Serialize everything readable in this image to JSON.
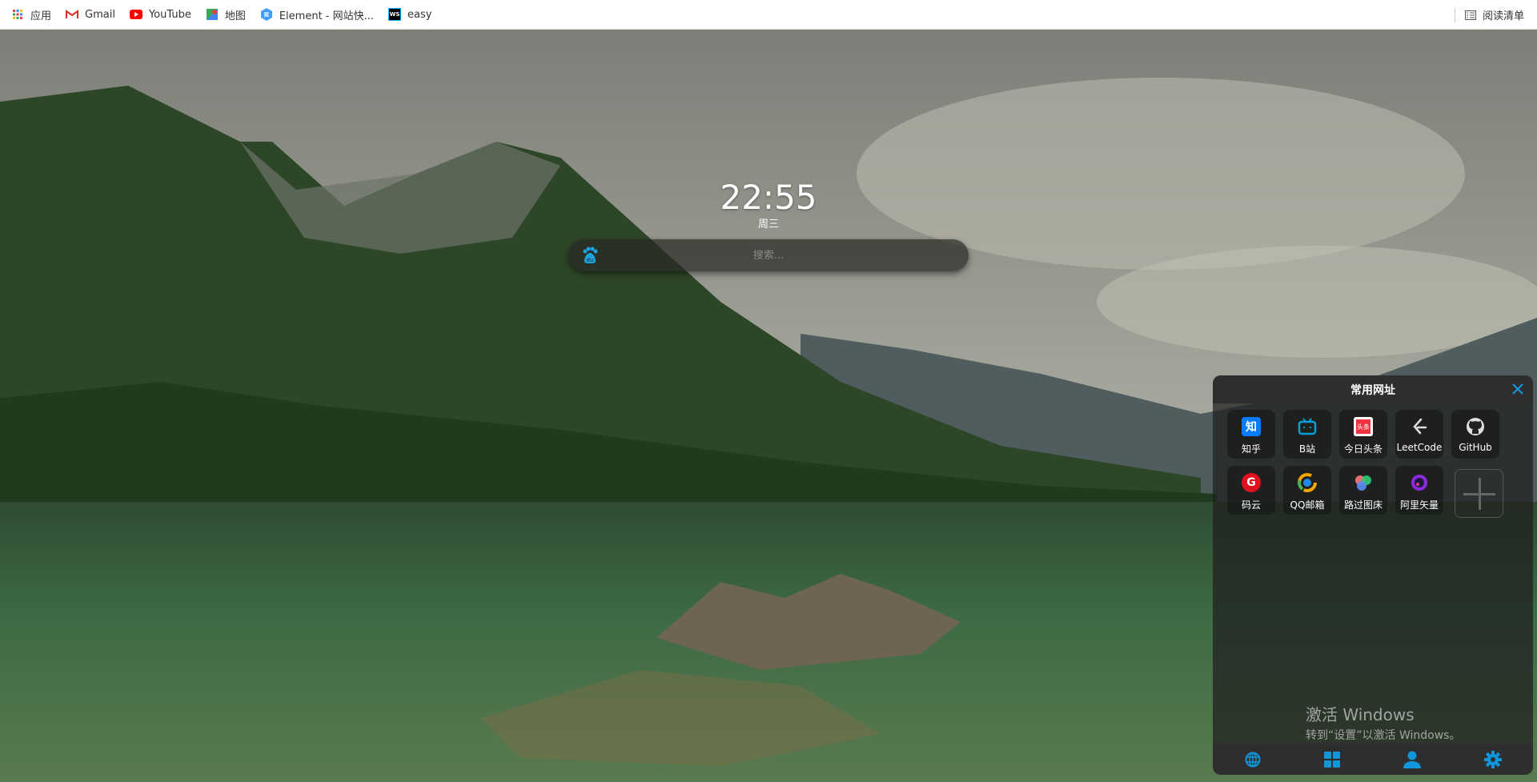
{
  "bookmarks": {
    "items": [
      {
        "label": "应用",
        "icon": "apps-grid-icon"
      },
      {
        "label": "Gmail",
        "icon": "gmail-icon"
      },
      {
        "label": "YouTube",
        "icon": "youtube-icon"
      },
      {
        "label": "地图",
        "icon": "maps-icon"
      },
      {
        "label": "Element - 网站快...",
        "icon": "element-icon"
      },
      {
        "label": "easy",
        "icon": "webstorm-icon"
      }
    ],
    "reading_list": "阅读清单"
  },
  "clock": {
    "time": "22:55",
    "weekday": "周三"
  },
  "search": {
    "placeholder": "搜索...",
    "engine_icon": "baidu-icon",
    "value": ""
  },
  "panel": {
    "title": "常用网址",
    "sites": [
      {
        "label": "知乎",
        "color": "#0a7cff"
      },
      {
        "label": "B站",
        "color": "#00a1d6"
      },
      {
        "label": "今日头条",
        "color": "#f0313c"
      },
      {
        "label": "LeetCode",
        "color": "#dddddd"
      },
      {
        "label": "GitHub",
        "color": "#dddddd"
      },
      {
        "label": "码云",
        "color": "#e0101f"
      },
      {
        "label": "QQ邮箱",
        "color": "#f7a600"
      },
      {
        "label": "路过图床",
        "color": "#e86f6f"
      },
      {
        "label": "阿里矢量",
        "color": "#8a2be2"
      }
    ],
    "footer_icons": [
      "globe-icon",
      "grid-icon",
      "user-icon",
      "settings-icon"
    ],
    "accent": "#1296db"
  },
  "watermark": {
    "title": "激活 Windows",
    "subtitle": "转到“设置”以激活 Windows。"
  }
}
